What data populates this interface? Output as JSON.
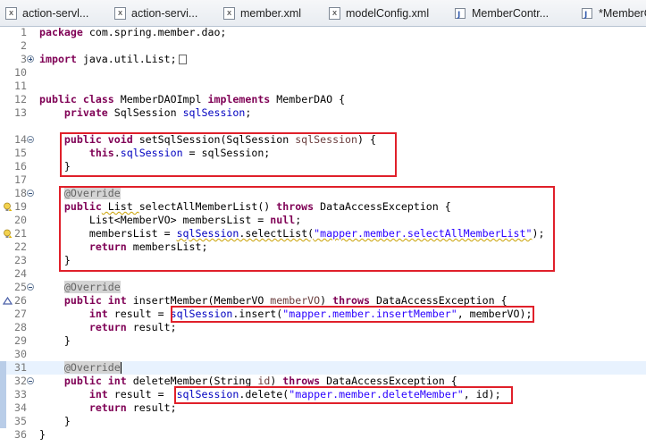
{
  "tabs": [
    {
      "label": "action-servl...",
      "icon": "xml-icon"
    },
    {
      "label": "action-servi...",
      "icon": "xml-icon"
    },
    {
      "label": "member.xml",
      "icon": "xml-icon"
    },
    {
      "label": "modelConfig.xml",
      "icon": "xml-icon"
    },
    {
      "label": "MemberContr...",
      "icon": "java-file-icon"
    },
    {
      "label": "*MemberC",
      "icon": "java-file-icon"
    }
  ],
  "editor": {
    "lines": [
      {
        "num": "1"
      },
      {
        "num": "2"
      },
      {
        "num": "3"
      },
      {
        "num": "10"
      },
      {
        "num": "11"
      },
      {
        "num": "12"
      },
      {
        "num": "13"
      },
      {
        "num": "14"
      },
      {
        "num": "15"
      },
      {
        "num": "16"
      },
      {
        "num": "17"
      },
      {
        "num": "18"
      },
      {
        "num": "19"
      },
      {
        "num": "20"
      },
      {
        "num": "21"
      },
      {
        "num": "22"
      },
      {
        "num": "23"
      },
      {
        "num": "24"
      },
      {
        "num": "25"
      },
      {
        "num": "26"
      },
      {
        "num": "27"
      },
      {
        "num": "28"
      },
      {
        "num": "29"
      },
      {
        "num": "30"
      },
      {
        "num": "31"
      },
      {
        "num": "32"
      },
      {
        "num": "33"
      },
      {
        "num": "34"
      },
      {
        "num": "35"
      },
      {
        "num": "36"
      }
    ],
    "code": {
      "l1": {
        "kw": "package",
        "rest": " com.spring.member.dao;"
      },
      "l3": {
        "kw": "import",
        "rest": " java.util.List;"
      },
      "l11": {
        "kw1": "public",
        "kw2": "class",
        "mid": " MemberDAOImpl ",
        "kw3": "implements",
        "rest": " MemberDAO {"
      },
      "l12": {
        "kw": "private",
        "type": " SqlSession ",
        "field": "sqlSession",
        "rest": ";"
      },
      "l14": {
        "kw1": "public",
        "kw2": "void",
        "mid": " setSqlSession(SqlSession ",
        "param": "sqlSession",
        "rest": ") {"
      },
      "l15": {
        "kw": "this",
        "dot": ".",
        "field": "sqlSession",
        "rest": " = sqlSession;"
      },
      "l16": {
        "text": "}"
      },
      "l18": {
        "ann": "@Override"
      },
      "l19": {
        "kw1": "public",
        "type": " List ",
        "mid": "selectAllMemberList() ",
        "kw2": "throws",
        "rest": " DataAccessException {"
      },
      "l20": {
        "type": "List<MemberVO> membersList = ",
        "kw": "null",
        "rest": ";"
      },
      "l21": {
        "pre": "membersList = ",
        "field": "sqlSession",
        "call": ".selectList(",
        "str": "\"mapper.member.selectAllMemberList\"",
        "rest": ");"
      },
      "l22": {
        "kw": "return",
        "rest": " membersList;"
      },
      "l23": {
        "text": "}"
      },
      "l25": {
        "ann": "@Override"
      },
      "l26": {
        "kw1": "public",
        "kw2": "int",
        "mid": " insertMember(MemberVO ",
        "param": "memberVO",
        "close": ") ",
        "kw3": "throws",
        "rest": " DataAccessException {"
      },
      "l27": {
        "kw": "int",
        "pre": " result = ",
        "field": "sqlSession",
        "call": ".insert(",
        "str": "\"mapper.member.insertMember\"",
        "rest": ", memberVO);"
      },
      "l28": {
        "kw": "return",
        "rest": " result;"
      },
      "l29": {
        "text": "}"
      },
      "l31": {
        "ann": "@Override"
      },
      "l32": {
        "kw1": "public",
        "kw2": "int",
        "mid": " deleteMember(String ",
        "param": "id",
        "close": ") ",
        "kw3": "throws",
        "rest": " DataAccessException {"
      },
      "l33": {
        "kw": "int",
        "pre": " result =  ",
        "field": "sqlSession",
        "call": ".delete(",
        "str": "\"mapper.member.deleteMember\"",
        "rest": ", id);"
      },
      "l34": {
        "kw": "return",
        "rest": " result;"
      },
      "l35": {
        "text": "}"
      },
      "l36": {
        "text": "}"
      }
    }
  },
  "colors": {
    "keyword": "#7f0055",
    "field": "#0000c0",
    "string": "#2a00ff",
    "annotation": "#646464",
    "highlight_box": "#e0202a",
    "current_line": "#e8f2fe"
  }
}
